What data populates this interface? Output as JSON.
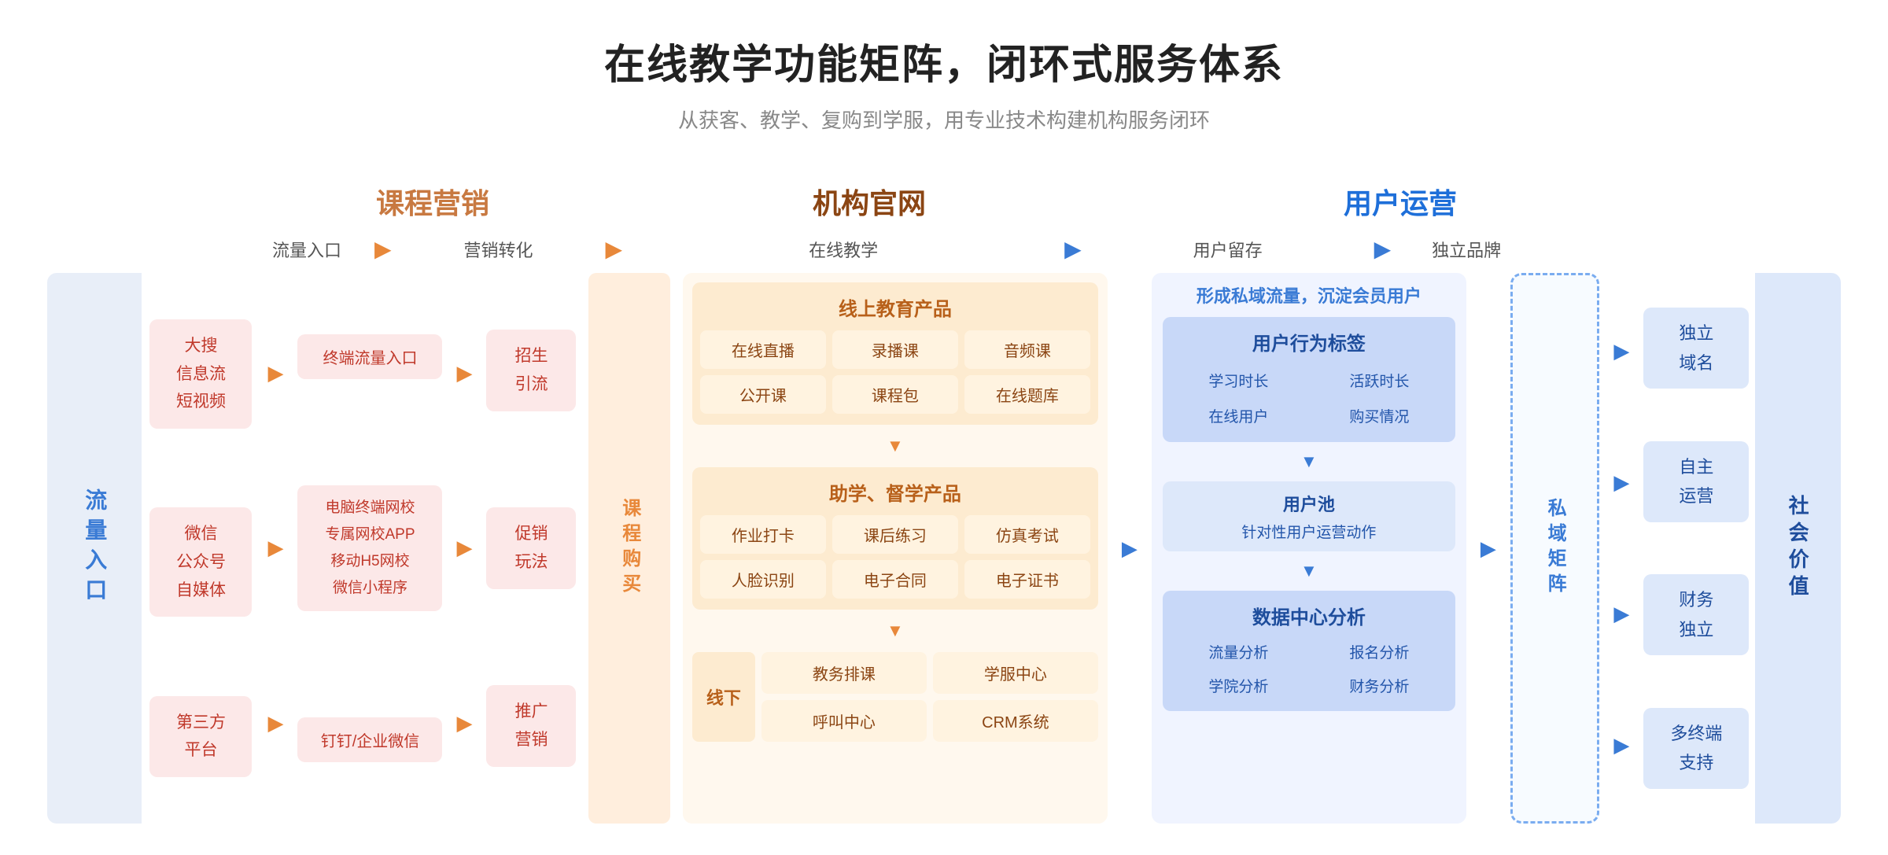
{
  "page": {
    "title": "在线教学功能矩阵，闭环式服务体系",
    "subtitle": "从获客、教学、复购到学服，用专业技术构建机构服务闭环"
  },
  "section_headers": {
    "marketing": "课程营销",
    "official": "机构官网",
    "user_ops": "用户运营"
  },
  "flow_steps": {
    "step1": "流量入口",
    "step2": "营销转化",
    "step3": "在线教学",
    "step4": "用户留存",
    "step5": "独立品牌"
  },
  "left_label": "流\n量\n入\n口",
  "traffic_sources": [
    {
      "text": "大搜\n信息流\n短视频"
    },
    {
      "text": "微信\n公众号\n自媒体"
    },
    {
      "text": "第三方\n平台"
    }
  ],
  "marketing_items_left": [
    {
      "text": "终端流量入口"
    },
    {
      "text": "电脑终端网校\n专属网校APP\n移动H5网校\n微信小程序"
    },
    {
      "text": "钉钉/企业微信"
    }
  ],
  "marketing_items_right": [
    {
      "text": "招生\n引流"
    },
    {
      "text": "促销\n玩法"
    },
    {
      "text": "推广\n营销"
    }
  ],
  "course_buy_label": "课\n程\n购\n买",
  "online_teaching": {
    "section1_title": "线上教育产品",
    "section1_cells": [
      "在线直播",
      "录播课",
      "音频课",
      "公开课",
      "课程包",
      "在线题库"
    ],
    "section2_title": "助学、督学产品",
    "section2_cells": [
      "作业打卡",
      "课后练习",
      "仿真考试",
      "人脸识别",
      "电子合同",
      "电子证书"
    ],
    "xiaxian_label": "线下",
    "xiaxian_cells": [
      "教务排课",
      "学服中心",
      "呼叫中心",
      "CRM系统"
    ]
  },
  "user_retention": {
    "top_text": "形成私域流量，沉淀会员用户",
    "behavior_title": "用户行为标签",
    "behavior_cells": [
      "学习时长",
      "活跃时长",
      "在线用户",
      "购买情况"
    ],
    "user_pool_title": "用户池",
    "user_pool_sub": "针对性用户运营动作",
    "data_center_title": "数据中心分析",
    "data_cells": [
      "流量分析",
      "报名分析",
      "学院分析",
      "财务分析"
    ]
  },
  "private_domain_label": "私\n域\n矩\n阵",
  "brand_items": [
    {
      "text": "独立\n域名"
    },
    {
      "text": "自主\n运营"
    },
    {
      "text": "财务\n独立"
    },
    {
      "text": "多终端\n支持"
    }
  ],
  "social_value_label": "社\n会\n价\n值",
  "arrows": {
    "orange_circle": "▶",
    "blue_circle": "▶",
    "right": "▶",
    "down": "▼"
  }
}
